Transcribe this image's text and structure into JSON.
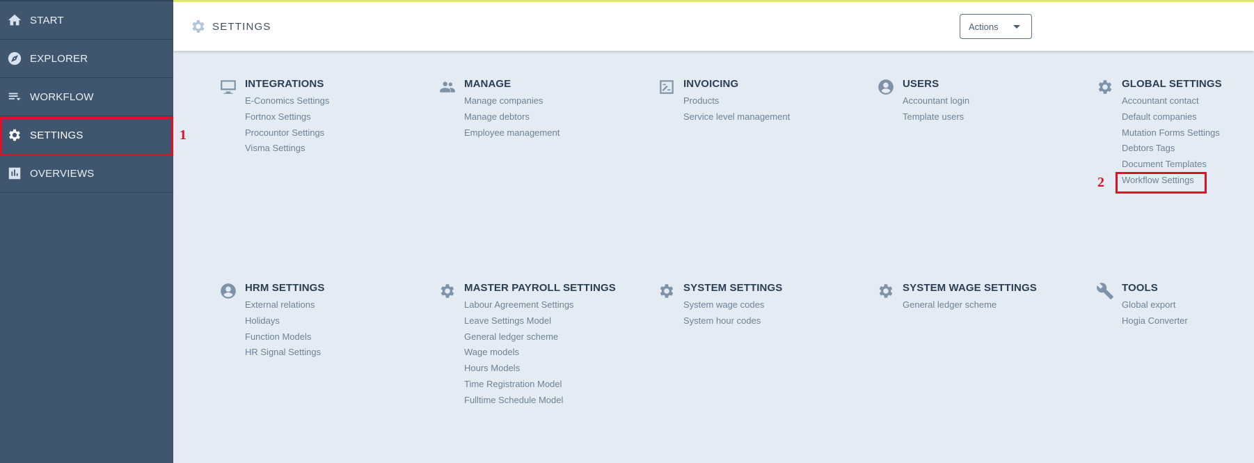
{
  "sidebar": {
    "items": [
      {
        "label": "START",
        "icon": "home-icon"
      },
      {
        "label": "EXPLORER",
        "icon": "compass-icon"
      },
      {
        "label": "WORKFLOW",
        "icon": "list-icon"
      },
      {
        "label": "SETTINGS",
        "icon": "gear-icon"
      },
      {
        "label": "OVERVIEWS",
        "icon": "chart-icon"
      }
    ]
  },
  "header": {
    "title": "SETTINGS",
    "actions_label": "Actions"
  },
  "annotations": {
    "marker_1": "1",
    "marker_2": "2"
  },
  "groups": [
    {
      "title": "INTEGRATIONS",
      "icon": "monitor-icon",
      "links": [
        "E-Conomics Settings",
        "Fortnox Settings",
        "Procountor Settings",
        "Visma Settings"
      ]
    },
    {
      "title": "MANAGE",
      "icon": "people-icon",
      "links": [
        "Manage companies",
        "Manage debtors",
        "Employee management"
      ]
    },
    {
      "title": "INVOICING",
      "icon": "invoice-icon",
      "links": [
        "Products",
        "Service level management"
      ]
    },
    {
      "title": "USERS",
      "icon": "user-circle-icon",
      "links": [
        "Accountant login",
        "Template users"
      ]
    },
    {
      "title": "GLOBAL SETTINGS",
      "icon": "gear-icon",
      "links": [
        "Accountant contact",
        "Default companies",
        "Mutation Forms Settings",
        "Debtors Tags",
        "Document Templates",
        "Workflow Settings"
      ]
    },
    {
      "title": "HRM SETTINGS",
      "icon": "user-circle-icon",
      "links": [
        "External relations",
        "Holidays",
        "Function Models",
        "HR Signal Settings"
      ]
    },
    {
      "title": "MASTER PAYROLL SETTINGS",
      "icon": "gear-icon",
      "links": [
        "Labour Agreement Settings",
        "Leave Settings Model",
        "General ledger scheme",
        "Wage models",
        "Hours Models",
        "Time Registration Model",
        "Fulltime Schedule Model"
      ]
    },
    {
      "title": "SYSTEM SETTINGS",
      "icon": "gear-icon",
      "links": [
        "System wage codes",
        "System hour codes"
      ]
    },
    {
      "title": "SYSTEM WAGE SETTINGS",
      "icon": "gear-icon",
      "links": [
        "General ledger scheme"
      ]
    },
    {
      "title": "TOOLS",
      "icon": "wrench-icon",
      "links": [
        "Global export",
        "Hogia Converter"
      ]
    }
  ]
}
